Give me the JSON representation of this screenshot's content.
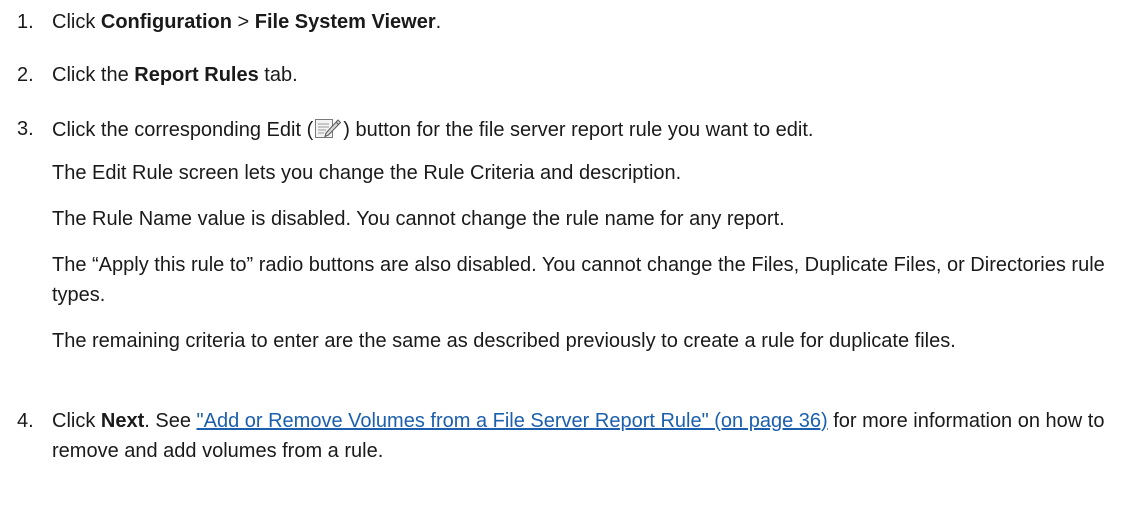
{
  "steps": [
    {
      "number": "1.",
      "prefix": "Click ",
      "bold1": "Configuration",
      "mid": " > ",
      "bold2": "File System Viewer",
      "suffix": "."
    },
    {
      "number": "2.",
      "prefix": "Click the ",
      "bold": "Report Rules",
      "suffix": " tab."
    },
    {
      "number": "3.",
      "prefix": "Click the corresponding Edit (",
      "icon": "edit-icon",
      "suffix": ") button for the file server report rule you want to edit.",
      "paragraphs": [
        "The Edit Rule screen lets you change the Rule Criteria and description.",
        "The Rule Name value is disabled. You cannot change the rule name for any report.",
        "The “Apply this rule to” radio buttons are also disabled. You cannot change the Files, Duplicate Files, or Directories rule types.",
        "The remaining criteria to enter are the same as described previously to create a rule for duplicate files."
      ]
    },
    {
      "number": "4.",
      "prefix": "Click ",
      "bold": "Next",
      "mid": ". See ",
      "link": "\"Add or Remove Volumes from a File Server Report Rule\" (on page 36)",
      "suffix": " for more information on how to remove and add volumes from a rule."
    }
  ]
}
